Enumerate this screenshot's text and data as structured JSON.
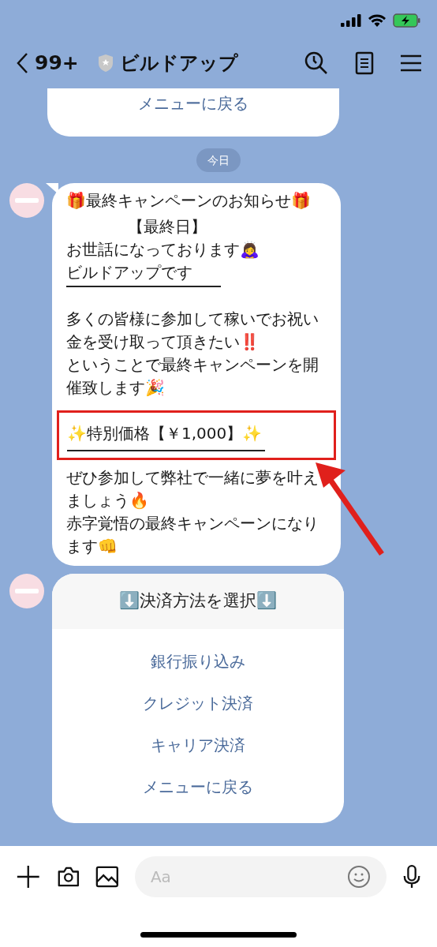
{
  "header": {
    "unread_count": "99+",
    "title": "ビルドアップ"
  },
  "previous_menu": {
    "options": [
      "メニューに戻る"
    ]
  },
  "date_chip": "今日",
  "message": {
    "blocks": [
      {
        "kind": "text",
        "lines": [
          "🎁最終キャンペーンのお知らせ🎁"
        ]
      },
      {
        "kind": "indented",
        "lines": [
          "【最終日】"
        ]
      },
      {
        "kind": "text",
        "lines": [
          "お世話になっております🙇‍♀️",
          "ビルドアップです"
        ]
      },
      {
        "kind": "rule"
      },
      {
        "kind": "spaced",
        "lines": [
          "多くの皆様に参加して稼いでお祝い金を受け取って頂きたい‼️",
          "ということで最終キャンペーンを開催致します🎉"
        ]
      },
      {
        "kind": "price",
        "lines": [
          "✨特別価格【￥1,000】✨"
        ],
        "highlighted": true
      },
      {
        "kind": "text",
        "lines": [
          "ぜひ参加して弊社で一緒に夢を叶えましょう🔥",
          "赤字覚悟の最終キャンペーンになります👊"
        ]
      }
    ]
  },
  "menu": {
    "title": "⬇️決済方法を選択⬇️",
    "options": [
      "銀行振り込み",
      "クレジット決済",
      "キャリア決済",
      "メニューに戻る"
    ]
  },
  "input": {
    "placeholder": "Aa"
  }
}
